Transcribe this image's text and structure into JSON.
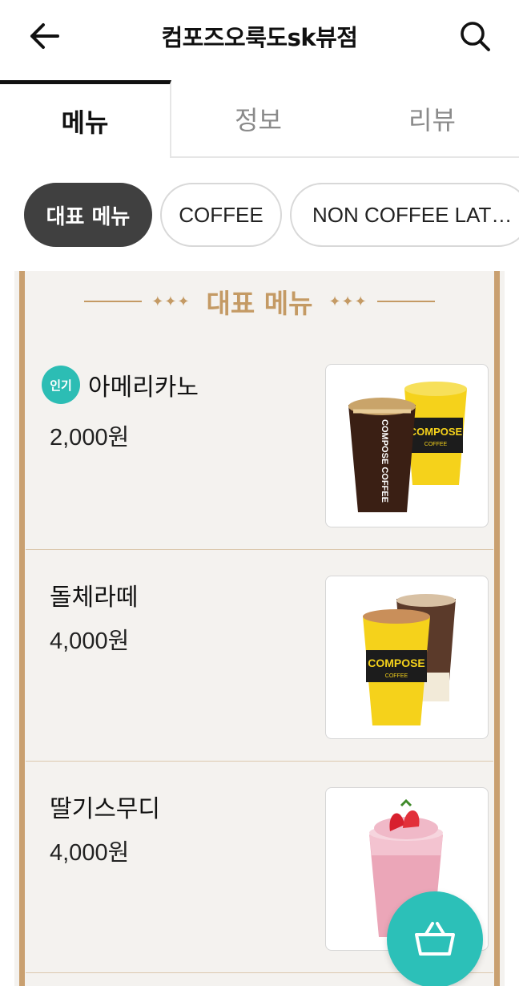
{
  "header": {
    "title": "컴포즈오룩도sk뷰점",
    "back_icon": "arrow-left-icon",
    "search_icon": "search-icon"
  },
  "tabs": [
    {
      "label": "메뉴",
      "active": true
    },
    {
      "label": "정보",
      "active": false
    },
    {
      "label": "리뷰",
      "active": false
    }
  ],
  "chips": [
    {
      "label": "대표 메뉴",
      "selected": true
    },
    {
      "label": "COFFEE",
      "selected": false
    },
    {
      "label": "NON COFFEE LAT…",
      "selected": false
    }
  ],
  "section": {
    "title": "대표 메뉴"
  },
  "items": [
    {
      "name": "아메리카노",
      "price": "2,000원",
      "badge": "인기"
    },
    {
      "name": "돌체라떼",
      "price": "4,000원",
      "badge": ""
    },
    {
      "name": "딸기스무디",
      "price": "4,000원",
      "badge": ""
    }
  ],
  "brand": {
    "cup_text_1": "COMPOSE",
    "cup_text_2": "COFFEE",
    "yellow": "#f5d21b",
    "dark": "#1c1c1c"
  },
  "colors": {
    "accent": "#2cc0b8",
    "gold": "#c49a64",
    "chip_selected": "#404040"
  },
  "fab": {
    "icon": "shopping-basket-icon"
  }
}
